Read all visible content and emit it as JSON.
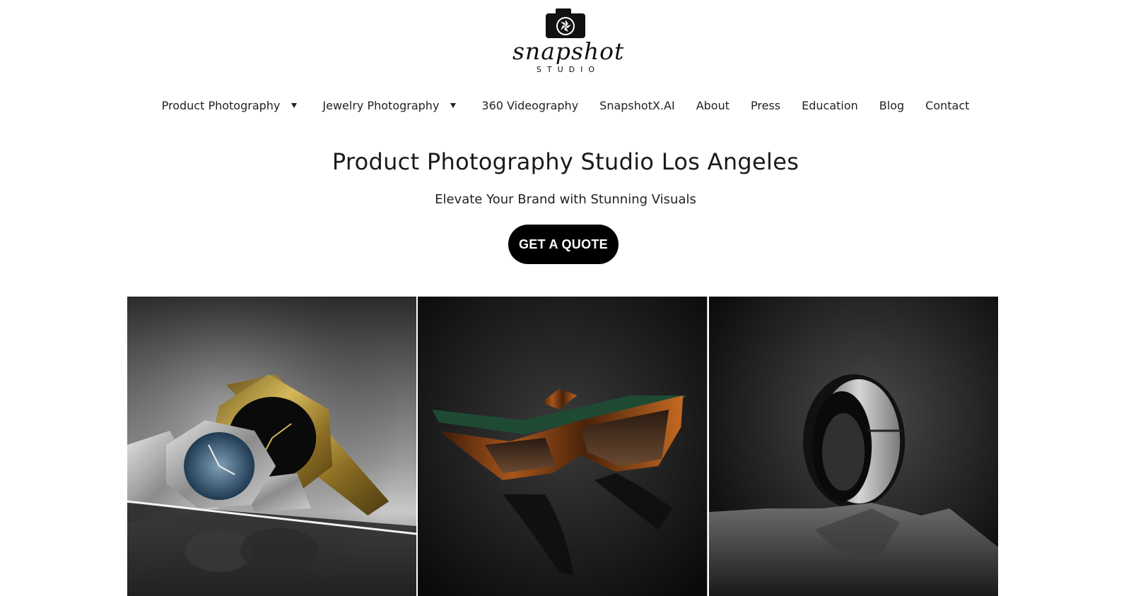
{
  "logo": {
    "wordmark": "snapshot",
    "subtitle": "STUDIO",
    "icon": "camera-aperture-icon"
  },
  "nav": {
    "items": [
      {
        "label": "Product Photography",
        "has_dropdown": true
      },
      {
        "label": "Jewelry Photography",
        "has_dropdown": true
      },
      {
        "label": "360 Videography",
        "has_dropdown": false
      },
      {
        "label": "SnapshotX.AI",
        "has_dropdown": false
      },
      {
        "label": "About",
        "has_dropdown": false
      },
      {
        "label": "Press",
        "has_dropdown": false
      },
      {
        "label": "Education",
        "has_dropdown": false
      },
      {
        "label": "Blog",
        "has_dropdown": false
      },
      {
        "label": "Contact",
        "has_dropdown": false
      }
    ]
  },
  "hero": {
    "title": "Product Photography Studio Los Angeles",
    "subtitle": "Elevate Your Brand with Stunning Visuals",
    "cta_label": "GET A QUOTE"
  },
  "gallery": {
    "images": [
      {
        "subject": "watches"
      },
      {
        "subject": "sunglasses"
      },
      {
        "subject": "ring"
      }
    ]
  },
  "colors": {
    "background": "#ffffff",
    "text": "#111111",
    "button_bg": "#000000",
    "button_text": "#ffffff"
  }
}
